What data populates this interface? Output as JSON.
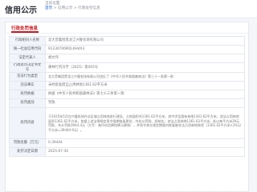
{
  "header": {
    "title": "信用公示",
    "sub_title": "当前位置",
    "breadcrumb": {
      "home": "首页",
      "sep1": " > ",
      "section": "信用公示",
      "sep2": " > ",
      "current": "行政处罚信息"
    }
  },
  "card": {
    "title": "行政处罚信息"
  },
  "rows": [
    {
      "label": "行政相对人名称",
      "value": "北大荒集团黑龙江兴隆农场有限公司"
    },
    {
      "label": "统一社会信用代码",
      "value": "91230706M2LKH4X3"
    },
    {
      "label": "法定代表人",
      "value": "胡文伟"
    },
    {
      "label": "行政处罚决定书文号",
      "value": "黄林行罚决字〔2025〕第005号"
    },
    {
      "label": "违法行为类型",
      "value": "北大荒集团黑龙江兴隆农场有限公司违反了《中华人民共和国森林法》第三十一条第一款"
    },
    {
      "label": "违法事实",
      "value": "未经批准擅自占用林地1361.62平方米"
    },
    {
      "label": "处罚依据",
      "value": "依据《中华人民共和国森林法》第七十三条第一款"
    },
    {
      "label": "处罚类别",
      "value": "罚款"
    },
    {
      "label": "处罚内容",
      "value": "于2025年5月在兴隆农场作业区域占用林地进行建设，占地面积共1361.62平方米，其中涉及国有林地1361.62平方米，违法占用林地面积1361.62平方米，依据上述法律规定责令限期恢复原状，并处以罚款。经核实，违法占用林地1361.62平方米，处以每平方米29元罚款，共计罚款3944.4元（大写：叁仟玖佰肆拾肆元肆角），并责令其在规定期限内恢复被非法占用林地原状（1361.62平方米×29元/平方米=39444.9元）。"
    },
    {
      "label": "罚款金额（万元）",
      "value": "0.39444"
    },
    {
      "label": "处罚决定日期",
      "value": "2025-07-30"
    }
  ]
}
